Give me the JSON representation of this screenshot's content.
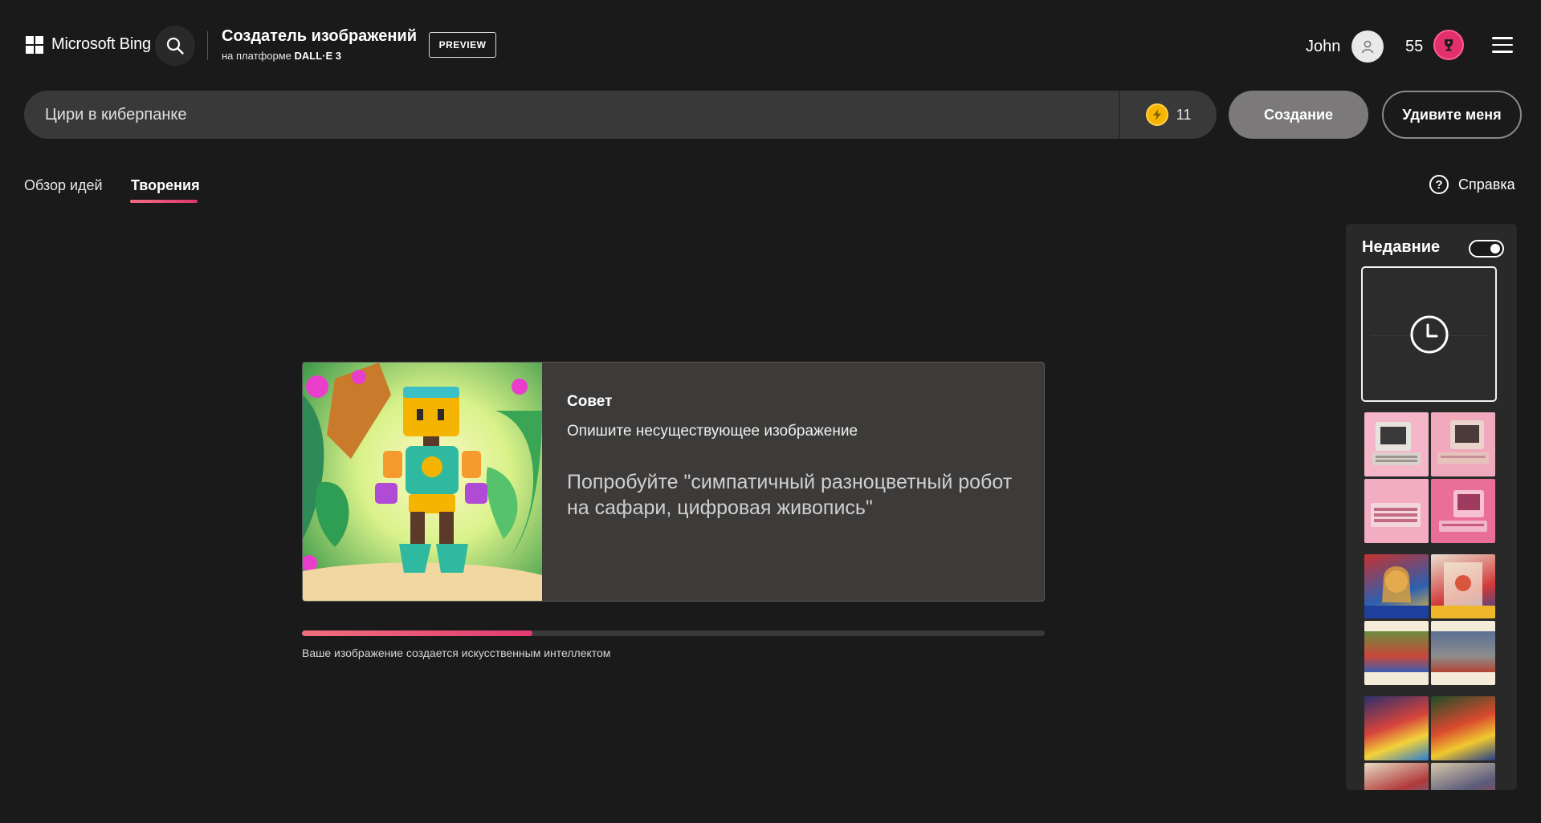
{
  "header": {
    "brand": "Microsoft Bing",
    "title": "Создатель изображений",
    "subtitle_prefix": "на платформе",
    "subtitle_model": "DALL·E 3",
    "badge": "PREVIEW",
    "user_name": "John",
    "points": "55"
  },
  "prompt": {
    "value": "Цири в киберпанке",
    "boosts": "11"
  },
  "buttons": {
    "create": "Создание",
    "surprise": "Удивите меня"
  },
  "tabs": [
    {
      "label": "Обзор идей",
      "active": false
    },
    {
      "label": "Творения",
      "active": true
    }
  ],
  "help": {
    "label": "Справка",
    "icon": "question-circle-icon"
  },
  "tip": {
    "title": "Совет",
    "description": "Опишите несуществующее изображение",
    "example": "Попробуйте \"симпатичный разноцветный робот на сафари, цифровая живопись\""
  },
  "progress": {
    "value": 0.31,
    "label": "Ваше изображение создается искусственным интеллектом"
  },
  "recent": {
    "title": "Недавние",
    "toggle_on": true,
    "pending_icon": "clock-icon"
  },
  "colors": {
    "background": "#1b1a1a",
    "accent_pink": "#e33b72",
    "accent_coral": "#f06f7c",
    "card": "#3c3b3a",
    "bolt": "#f7b500"
  }
}
